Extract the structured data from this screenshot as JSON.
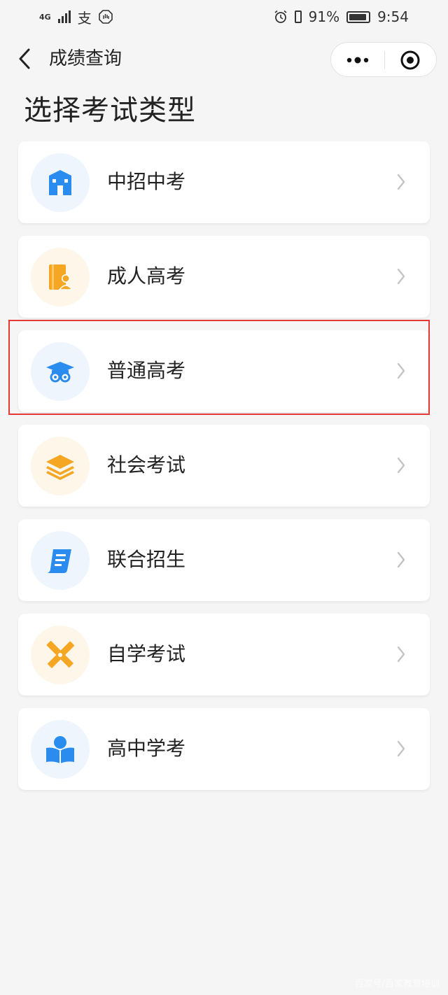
{
  "status_bar": {
    "network": "4G",
    "alipay_glyph": "支",
    "battery_percent": "91%",
    "battery_level": 0.91,
    "time": "9:54"
  },
  "nav": {
    "title": "成绩查询"
  },
  "page": {
    "title": "选择考试类型"
  },
  "exam_types": [
    {
      "label": "中招中考",
      "icon": "school-building-icon",
      "accent": "#2b8cf0",
      "bg": "#eef5fd"
    },
    {
      "label": "成人高考",
      "icon": "book-person-icon",
      "accent": "#f5a623",
      "bg": "#fff6ea"
    },
    {
      "label": "普通高考",
      "icon": "graduation-cap-icon",
      "accent": "#2b8cf0",
      "bg": "#eef5fd"
    },
    {
      "label": "社会考试",
      "icon": "layers-icon",
      "accent": "#f5a623",
      "bg": "#fff6ea"
    },
    {
      "label": "联合招生",
      "icon": "document-icon",
      "accent": "#2b8cf0",
      "bg": "#eef5fd"
    },
    {
      "label": "自学考试",
      "icon": "pencil-ruler-icon",
      "accent": "#f5a623",
      "bg": "#fff6ea"
    },
    {
      "label": "高中学考",
      "icon": "reading-book-icon",
      "accent": "#2b8cf0",
      "bg": "#eef5fd"
    }
  ],
  "highlighted_item": "普通高考",
  "watermark": "百家号/百家教育培训"
}
